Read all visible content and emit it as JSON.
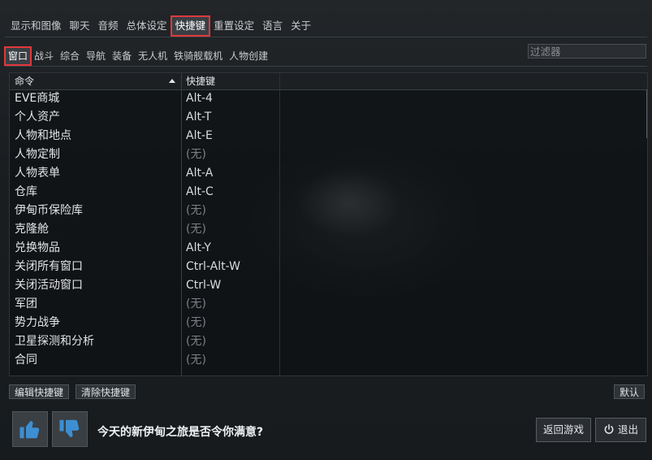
{
  "top_tabs": [
    "显示和图像",
    "聊天",
    "音频",
    "总体设定",
    "快捷键",
    "重置设定",
    "语言",
    "关于"
  ],
  "sub_tabs": [
    "窗口",
    "战斗",
    "综合",
    "导航",
    "装备",
    "无人机",
    "铁骑舰载机",
    "人物创建"
  ],
  "filter": {
    "placeholder": "过滤器"
  },
  "table": {
    "headers": {
      "command": "命令",
      "shortcut": "快捷键"
    },
    "rows": [
      {
        "command": "EVE商城",
        "shortcut": "Alt-4"
      },
      {
        "command": "个人资产",
        "shortcut": "Alt-T"
      },
      {
        "command": "人物和地点",
        "shortcut": "Alt-E"
      },
      {
        "command": "人物定制",
        "shortcut": "(无)"
      },
      {
        "command": "人物表单",
        "shortcut": "Alt-A"
      },
      {
        "command": "仓库",
        "shortcut": "Alt-C"
      },
      {
        "command": "伊甸币保险库",
        "shortcut": "(无)"
      },
      {
        "command": "克隆舱",
        "shortcut": "(无)"
      },
      {
        "command": "兑换物品",
        "shortcut": "Alt-Y"
      },
      {
        "command": "关闭所有窗口",
        "shortcut": "Ctrl-Alt-W"
      },
      {
        "command": "关闭活动窗口",
        "shortcut": "Ctrl-W"
      },
      {
        "command": "军团",
        "shortcut": "(无)"
      },
      {
        "command": "势力战争",
        "shortcut": "(无)"
      },
      {
        "command": "卫星探测和分析",
        "shortcut": "(无)"
      },
      {
        "command": "合同",
        "shortcut": "(无)"
      }
    ]
  },
  "buttons": {
    "edit_shortcut": "编辑快捷键",
    "clear_shortcut": "清除快捷键",
    "default": "默认",
    "return_game": "返回游戏",
    "quit": "退出"
  },
  "feedback": {
    "question": "今天的新伊甸之旅是否令你满意?"
  },
  "colors": {
    "accent_highlight": "#e0383d",
    "thumb_icon": "#3d8fd1"
  },
  "icons": {
    "like": "thumbs-up-icon",
    "dislike": "thumbs-down-icon",
    "power": "power-icon",
    "sort": "sort-ascending-icon"
  }
}
